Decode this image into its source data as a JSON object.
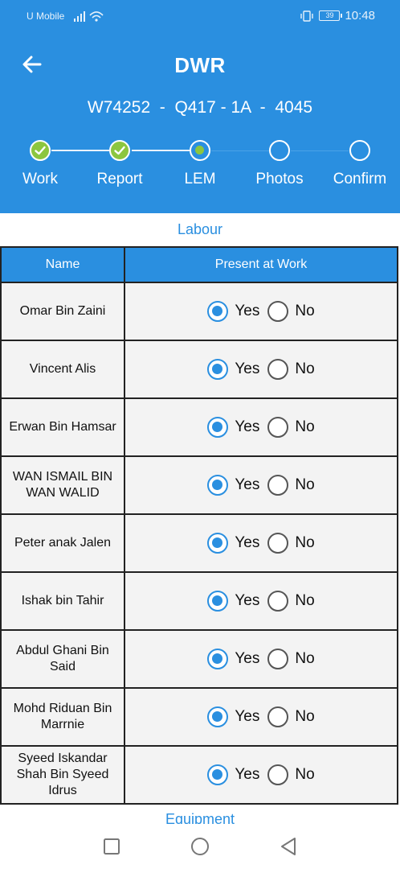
{
  "status_bar": {
    "carrier": "U Mobile",
    "battery": "39",
    "time": "10:48"
  },
  "header": {
    "title": "DWR",
    "subtitle": "W74252  -  Q417 - 1A  -  4045"
  },
  "stepper": [
    {
      "label": "Work",
      "state": "done"
    },
    {
      "label": "Report",
      "state": "done"
    },
    {
      "label": "LEM",
      "state": "current"
    },
    {
      "label": "Photos",
      "state": "todo"
    },
    {
      "label": "Confirm",
      "state": "todo"
    }
  ],
  "section": {
    "title": "Labour"
  },
  "table": {
    "headers": [
      "Name",
      "Present at Work"
    ],
    "yes_label": "Yes",
    "no_label": "No",
    "rows": [
      {
        "name": "Omar Bin Zaini",
        "present": "Yes"
      },
      {
        "name": "Vincent Alis",
        "present": "Yes"
      },
      {
        "name": "Erwan Bin Hamsar",
        "present": "Yes"
      },
      {
        "name": "WAN ISMAIL BIN WAN WALID",
        "present": "Yes"
      },
      {
        "name": "Peter anak Jalen",
        "present": "Yes"
      },
      {
        "name": "Ishak bin Tahir",
        "present": "Yes"
      },
      {
        "name": "Abdul Ghani Bin Said",
        "present": "Yes"
      },
      {
        "name": "Mohd Riduan Bin Marrnie",
        "present": "Yes"
      },
      {
        "name": "Syeed Iskandar Shah Bin Syeed Idrus",
        "present": "Yes"
      }
    ]
  },
  "next_section": {
    "title": "Equipment"
  },
  "colors": {
    "primary": "#2a8fe0",
    "done": "#8cc63f"
  }
}
